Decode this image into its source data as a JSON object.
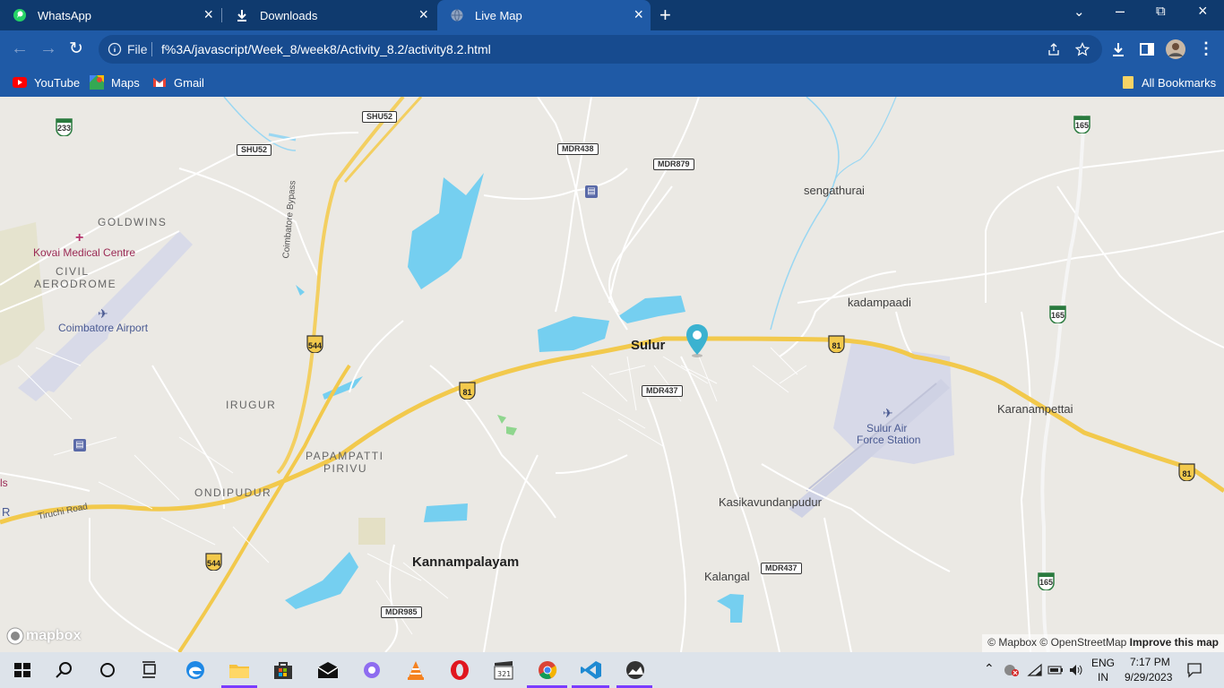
{
  "browser": {
    "tabs": [
      {
        "label": "WhatsApp",
        "icon": "whatsapp-icon",
        "active": false
      },
      {
        "label": "Downloads",
        "icon": "download-icon",
        "active": false
      },
      {
        "label": "Live Map",
        "icon": "globe-icon",
        "active": true
      }
    ],
    "address": {
      "scheme_label": "File",
      "url": "f%3A/javascript/Week_8/week8/Activity_8.2/activity8.2.html"
    },
    "bookmarks": [
      {
        "label": "YouTube",
        "icon": "youtube-icon"
      },
      {
        "label": "Maps",
        "icon": "google-maps-icon"
      },
      {
        "label": "Gmail",
        "icon": "gmail-icon"
      }
    ],
    "all_bookmarks_label": "All Bookmarks",
    "colors": {
      "tabbar": "#0f3a6e",
      "toolbar": "#1f5aa6"
    }
  },
  "map": {
    "places": {
      "sulur": "Sulur",
      "kannampalayam": "Kannampalayam",
      "sengathurai": "sengathurai",
      "kadampaadi": "kadampaadi",
      "karanampettai": "Karanampettai",
      "kasikavundanpudur": "Kasikavundanpudur",
      "kalangal": "Kalangal",
      "goldwins": "GOLDWINS",
      "civil": "CIVIL",
      "aerodrome": "AERODROME",
      "irugur": "IRUGUR",
      "papampatti": "PAPAMPATTI",
      "pirivu": "PIRIVU",
      "ondipudur": "ONDIPUDUR",
      "kovai_medical": "Kovai Medical Centre",
      "coimbatore_airport": "Coimbatore Airport",
      "sulur_air_1": "Sulur Air",
      "sulur_air_2": "Force Station",
      "coimbatore_bypass": "Coimbatore Bypass",
      "tiruchi_road": "Tiruchi Road",
      "edge_left_1": "ls",
      "edge_left_2": "R"
    },
    "shields": {
      "shu52_a": "SHU52",
      "shu52_b": "SHU52",
      "mdr438": "MDR438",
      "mdr879": "MDR879",
      "mdr437_a": "MDR437",
      "mdr437_b": "MDR437",
      "mdr985": "MDR985"
    },
    "highways": {
      "nh233": "233",
      "nh165_a": "165",
      "nh165_b": "165",
      "nh165_c": "165",
      "nh544_a": "544",
      "nh544_b": "544",
      "nh81_a": "81",
      "nh81_b": "81",
      "nh81_c": "81"
    },
    "logo": "mapbox",
    "attribution": {
      "mapbox": "© Mapbox",
      "osm": "© OpenStreetMap",
      "improve": "Improve this map"
    },
    "colors": {
      "water": "#75cff0",
      "highway": "#f2c94c",
      "marker": "#3bb2d0",
      "airport": "#d5d8e6"
    }
  },
  "taskbar": {
    "apps": [
      "windows-start-icon",
      "search-icon",
      "cortana-icon",
      "task-view-icon",
      "edge-icon",
      "file-explorer-icon",
      "microsoft-store-icon",
      "mail-icon",
      "photos-icon",
      "vlc-icon",
      "opera-icon",
      "clapper-icon",
      "chrome-icon",
      "vscode-icon",
      "steam-icon"
    ],
    "tray": {
      "lang1": "ENG",
      "lang2": "IN",
      "time": "7:17 PM",
      "date": "9/29/2023"
    }
  }
}
